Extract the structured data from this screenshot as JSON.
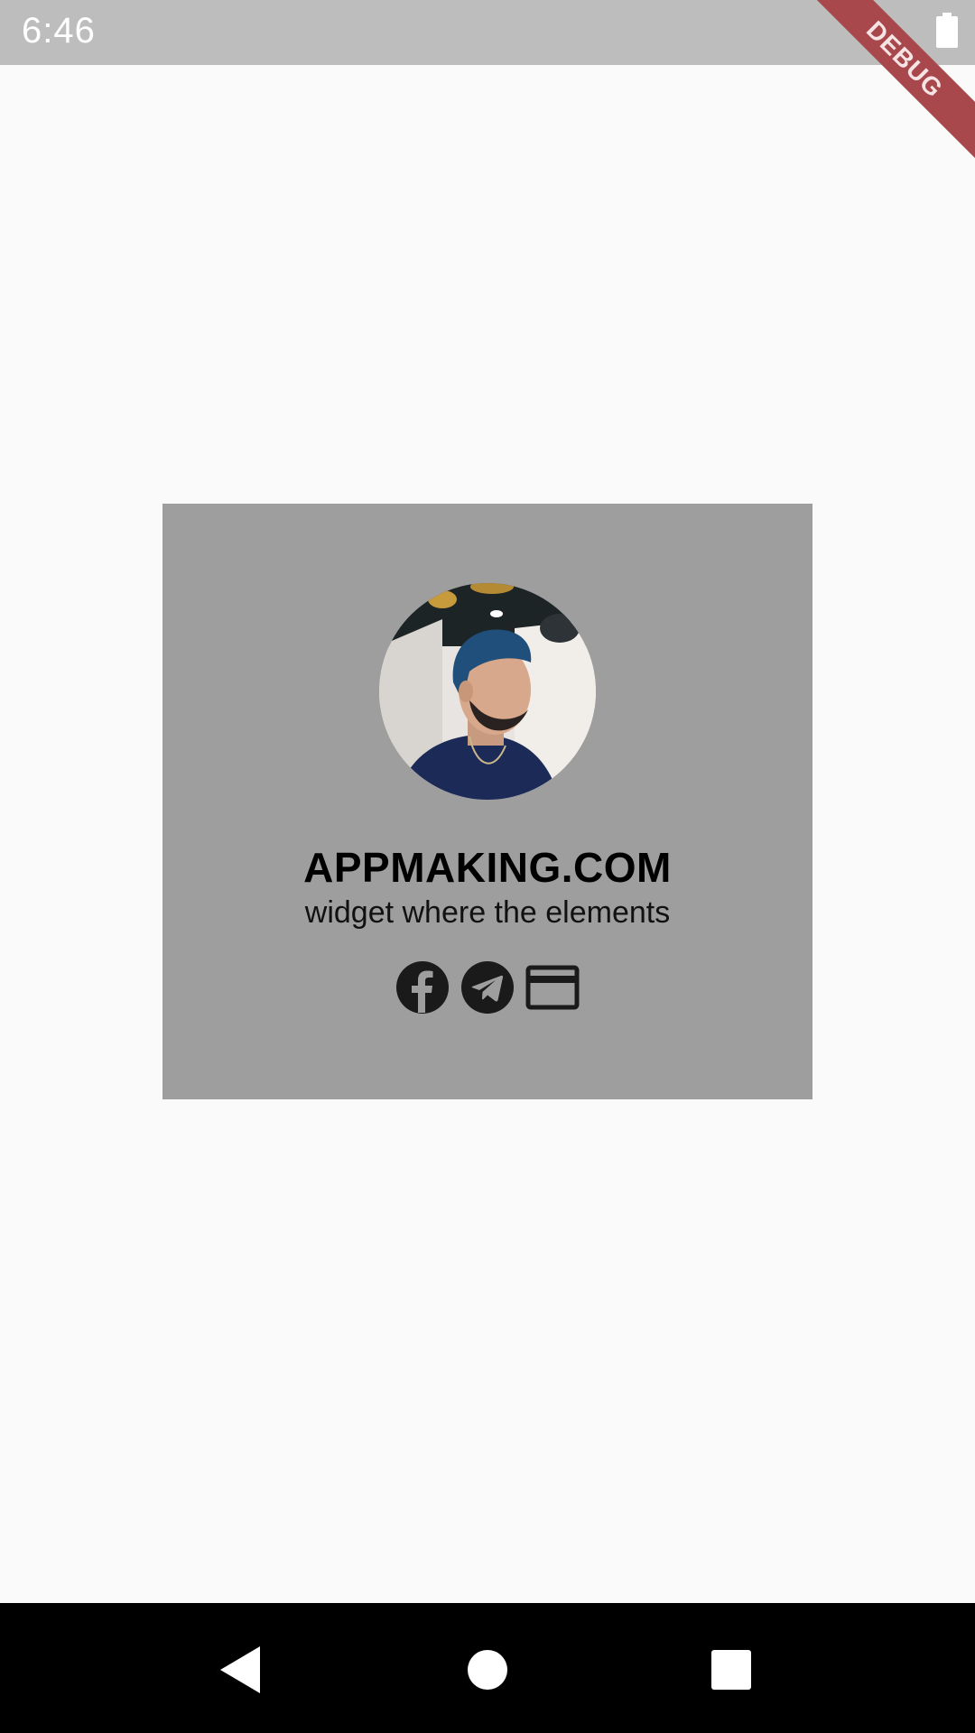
{
  "status_bar": {
    "time": "6:46",
    "battery_icon": "battery-full-icon"
  },
  "debug_banner": {
    "label": "DEBUG"
  },
  "profile_card": {
    "title": "APPMAKING.COM",
    "subtitle": "widget where the elements",
    "avatar": "profile-photo",
    "icons": [
      "facebook-icon",
      "telegram-icon",
      "credit-card-icon"
    ]
  },
  "navigation_bar": {
    "buttons": [
      "back-icon",
      "home-icon",
      "recents-icon"
    ]
  },
  "colors": {
    "background": "#fafafa",
    "status_bar": "#bdbdbd",
    "card": "#9e9e9e",
    "debug_ribbon": "#a8474c",
    "nav_bar": "#000000",
    "icon": "#1a1a1a"
  }
}
